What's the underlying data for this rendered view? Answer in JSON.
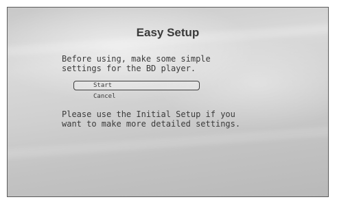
{
  "dialog": {
    "title": "Easy Setup",
    "intro_line1": "Before using, make some simple",
    "intro_line2": "settings for the BD player.",
    "menu": {
      "start_label": "Start",
      "cancel_label": "Cancel",
      "selected": "Start"
    },
    "note_line1": "Please use the Initial Setup if you",
    "note_line2": "want to make more detailed settings."
  }
}
